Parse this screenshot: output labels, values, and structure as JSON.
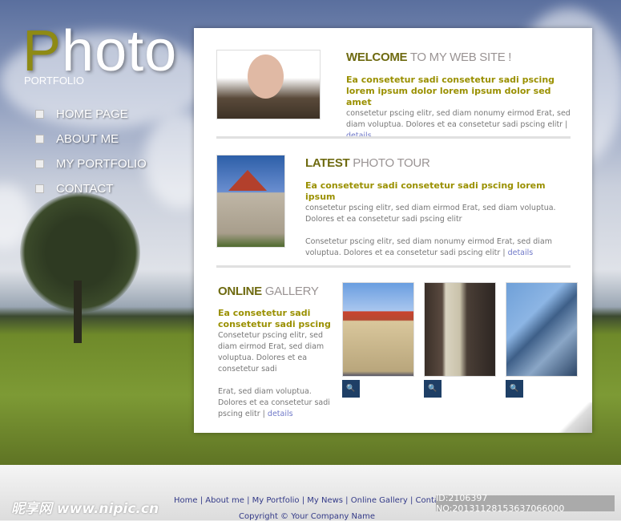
{
  "logo": {
    "first": "P",
    "rest": "hoto",
    "sub": "PORTFOLIO"
  },
  "nav": [
    "HOME PAGE",
    "ABOUT ME",
    "MY PORTFOLIO",
    "CONTACT"
  ],
  "welcome": {
    "a": "WELCOME",
    "b": " TO MY WEB SITE !",
    "lead": "Ea consetetur sadi consetetur sadi pscing lorem ipsum dolor lorem ipsum dolor sed amet",
    "text": "consetetur pscing elitr, sed diam nonumy eirmod Erat, sed diam voluptua. Dolores et ea consetetur sadi pscing elitr | ",
    "link": "details"
  },
  "tour": {
    "a": "LATEST",
    "b": " PHOTO TOUR",
    "lead": "Ea consetetur sadi consetetur sadi pscing lorem ipsum",
    "text1": "consetetur pscing elitr, sed diam eirmod Erat, sed diam voluptua. Dolores et ea consetetur sadi pscing elitr",
    "text2": "Consetetur pscing elitr, sed diam nonumy eirmod Erat, sed diam voluptua. Dolores et ea consetetur sadi pscing elitr | ",
    "link": "details"
  },
  "gallery": {
    "a": "ONLINE",
    "b": " GALLERY",
    "lead": "Ea consetetur sadi consetetur sadi pscing",
    "text1": "Consetetur pscing elitr, sed diam eirmod Erat, sed diam voluptua. Dolores et ea consetetur sadi",
    "text2": "Erat, sed diam voluptua. Dolores et ea consetetur sadi pscing elitr | ",
    "link": "details",
    "zoom_icon": "magnifier-icon"
  },
  "footer": {
    "links": [
      "Home",
      "About me",
      "My Portfolio",
      "My News",
      "Online Gallery",
      "Contacts"
    ],
    "copyright": "Copyright © Your Company Name",
    "watermark": "昵享网 www.nipic.cn",
    "id": "ID:2106397 NO:20131128153637066000"
  }
}
